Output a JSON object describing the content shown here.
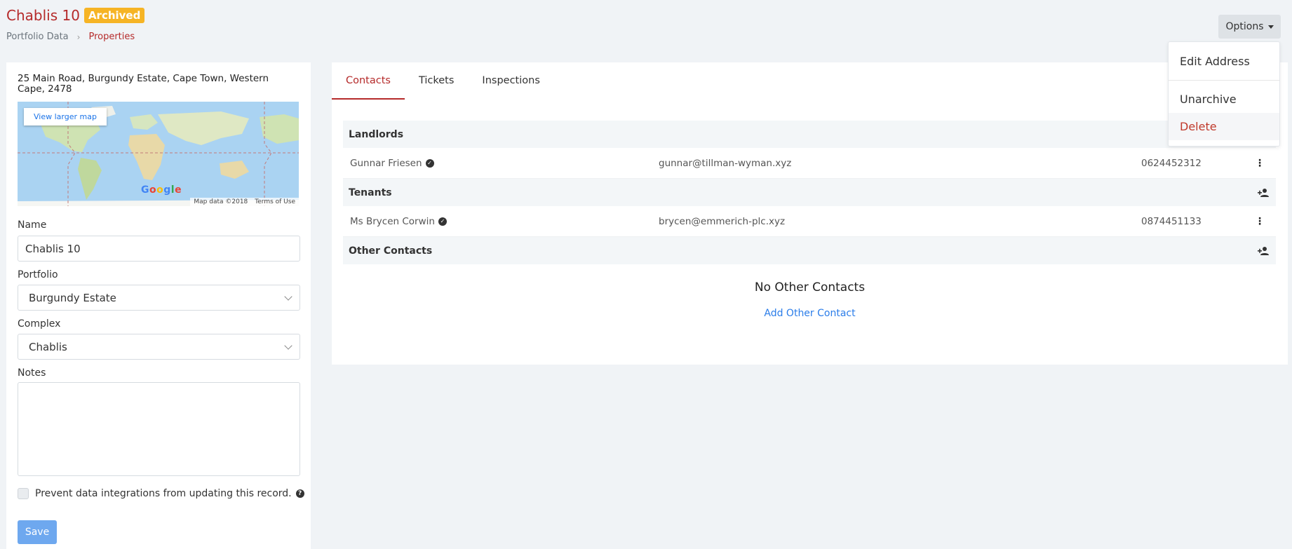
{
  "header": {
    "title": "Chablis 10",
    "status_badge": "Archived",
    "breadcrumb": [
      "Portfolio Data",
      "Properties"
    ],
    "options_label": "Options"
  },
  "options_menu": {
    "items": [
      "Edit Address",
      "Unarchive",
      "Delete"
    ]
  },
  "property": {
    "address": "25 Main Road, Burgundy Estate, Cape Town, Western Cape, 2478",
    "map": {
      "view_larger_label": "View larger map",
      "logo_text": "Google",
      "attribution": [
        "Map data ©2018",
        "Terms of Use"
      ]
    },
    "fields": {
      "name_label": "Name",
      "name_value": "Chablis 10",
      "portfolio_label": "Portfolio",
      "portfolio_value": "Burgundy Estate",
      "complex_label": "Complex",
      "complex_value": "Chablis",
      "notes_label": "Notes",
      "notes_value": ""
    },
    "prevent_integrations_label": "Prevent data integrations from updating this record.",
    "save_label": "Save"
  },
  "tabs": [
    "Contacts",
    "Tickets",
    "Inspections"
  ],
  "contacts": {
    "landlords": {
      "title": "Landlords",
      "rows": [
        {
          "name": "Gunnar Friesen",
          "email": "gunnar@tillman-wyman.xyz",
          "phone": "0624452312"
        }
      ]
    },
    "tenants": {
      "title": "Tenants",
      "rows": [
        {
          "name": "Ms Brycen Corwin",
          "email": "brycen@emmerich-plc.xyz",
          "phone": "0874451133"
        }
      ]
    },
    "other": {
      "title": "Other Contacts",
      "empty_title": "No Other Contacts",
      "add_label": "Add Other Contact"
    }
  },
  "colors": {
    "brand_red": "#b52a2a",
    "badge_yellow": "#f6b425",
    "link_blue": "#2b7de9",
    "save_blue": "#6ea8ef"
  }
}
